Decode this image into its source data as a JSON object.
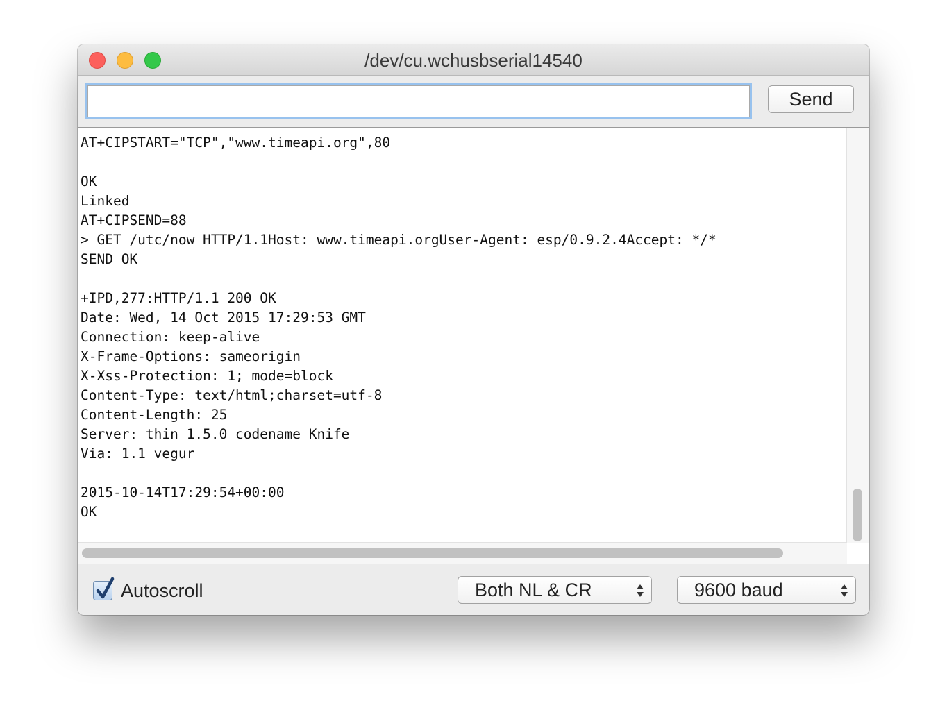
{
  "window": {
    "title": "/dev/cu.wchusbserial14540"
  },
  "input_bar": {
    "input_value": "",
    "send_label": "Send"
  },
  "console": {
    "lines": [
      "AT+CIPSTART=\"TCP\",\"www.timeapi.org\",80",
      "",
      "OK",
      "Linked",
      "AT+CIPSEND=88",
      "> GET /utc/now HTTP/1.1Host: www.timeapi.orgUser-Agent: esp/0.9.2.4Accept: */*",
      "SEND OK",
      "",
      "+IPD,277:HTTP/1.1 200 OK",
      "Date: Wed, 14 Oct 2015 17:29:53 GMT",
      "Connection: keep-alive",
      "X-Frame-Options: sameorigin",
      "X-Xss-Protection: 1; mode=block",
      "Content-Type: text/html;charset=utf-8",
      "Content-Length: 25",
      "Server: thin 1.5.0 codename Knife",
      "Via: 1.1 vegur",
      "",
      "2015-10-14T17:29:54+00:00",
      "OK"
    ]
  },
  "footer": {
    "autoscroll_label": "Autoscroll",
    "autoscroll_checked": true,
    "line_ending_value": "Both NL & CR",
    "baud_value": "9600 baud"
  },
  "colors": {
    "close": "#fc605c",
    "minimize": "#fdbc40",
    "maximize": "#34c84a",
    "focus_ring": "#98c2ee",
    "checkmark": "#1f3f6e"
  },
  "icons": {
    "close": "close-traffic-light-icon",
    "minimize": "minimize-traffic-light-icon",
    "maximize": "maximize-traffic-light-icon",
    "check": "checkmark-icon",
    "select": "up-down-arrows-icon"
  }
}
